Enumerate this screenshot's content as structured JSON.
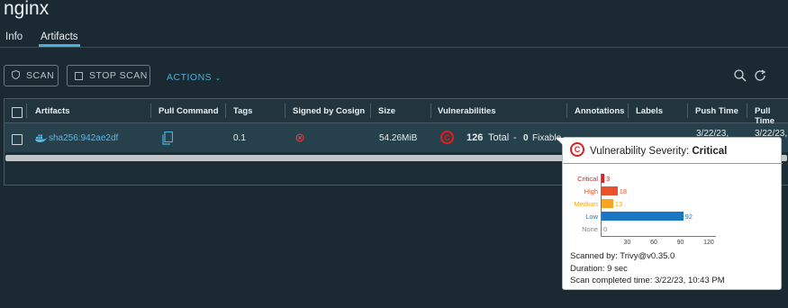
{
  "title": "nginx",
  "tabs": [
    {
      "label": "Info",
      "active": false
    },
    {
      "label": "Artifacts",
      "active": true
    }
  ],
  "toolbar": {
    "scan_label": "SCAN",
    "stop_scan_label": "STOP SCAN",
    "actions_label": "ACTIONS"
  },
  "table": {
    "headers": [
      "Artifacts",
      "Pull Command",
      "Tags",
      "Signed by Cosign",
      "Size",
      "Vulnerabilities",
      "Annotations",
      "Labels",
      "Push Time",
      "Pull Time"
    ],
    "row": {
      "artifact": "sha256:942ae2df",
      "tags": "0.1",
      "size": "54.26MiB",
      "vuln_total": "126",
      "vuln_total_label": "Total",
      "vuln_sep": "-",
      "vuln_fixable": "0",
      "vuln_fixable_label": "Fixable",
      "push_time": "3/22/23,",
      "pull_time": "3/22/23,",
      "severity_badge": "C"
    }
  },
  "popover": {
    "title_prefix": "Vulnerability Severity:",
    "title_value": "Critical",
    "badge": "C",
    "scanned_by": "Scanned by:  Trivy@v0.35.0",
    "duration": "Duration:  9 sec",
    "scan_completed": "Scan completed time: 3/22/23, 10:43 PM"
  },
  "chart_data": {
    "type": "bar",
    "orientation": "horizontal",
    "categories": [
      "Critical",
      "High",
      "Medium",
      "Low",
      "None"
    ],
    "values": [
      3,
      18,
      13,
      92,
      0
    ],
    "colors": [
      "#e02020",
      "#e8532b",
      "#f5a623",
      "#1a78c2",
      "#888888"
    ],
    "xticks": [
      "30",
      "60",
      "90",
      "120"
    ],
    "xlim": [
      0,
      130
    ]
  },
  "colors": {
    "accent": "#49afd9",
    "critical": "#e02020"
  }
}
